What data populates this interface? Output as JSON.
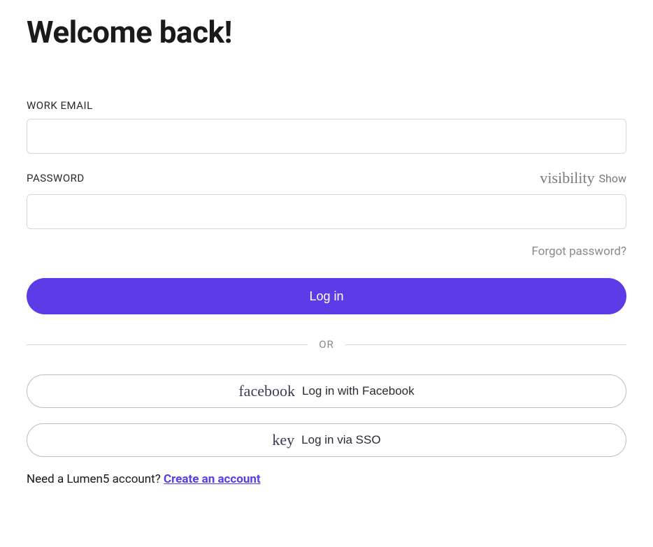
{
  "title": "Welcome back!",
  "email": {
    "label": "WORK EMAIL",
    "value": ""
  },
  "password": {
    "label": "PASSWORD",
    "value": "",
    "visibility_icon": "visibility",
    "show_text": "Show"
  },
  "forgot_password": "Forgot password?",
  "login_button": "Log in",
  "divider": "OR",
  "facebook": {
    "icon": "facebook",
    "label": "Log in with Facebook"
  },
  "sso": {
    "icon": "key",
    "label": "Log in via SSO"
  },
  "signup": {
    "prompt": "Need a Lumen5 account? ",
    "link": "Create an account"
  }
}
